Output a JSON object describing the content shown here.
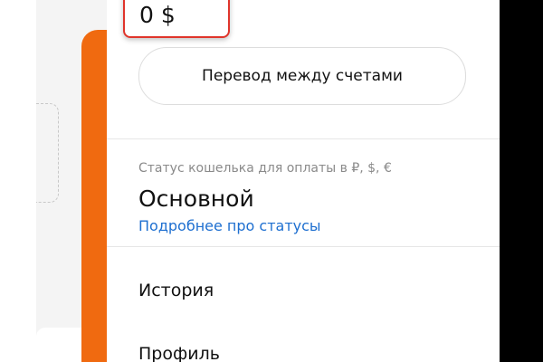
{
  "balance": {
    "value": "0 $"
  },
  "transfer": {
    "label": "Перевод между счетами"
  },
  "status": {
    "caption": "Статус кошелька для оплаты в ₽, $, €",
    "value": "Основной",
    "link": "Подробнее про статусы"
  },
  "menu": {
    "items": [
      {
        "label": "История"
      },
      {
        "label": "Профиль"
      }
    ]
  },
  "colors": {
    "accent_orange": "#f06a10",
    "highlight_red": "#e0352b",
    "link_blue": "#1e6fd0"
  }
}
